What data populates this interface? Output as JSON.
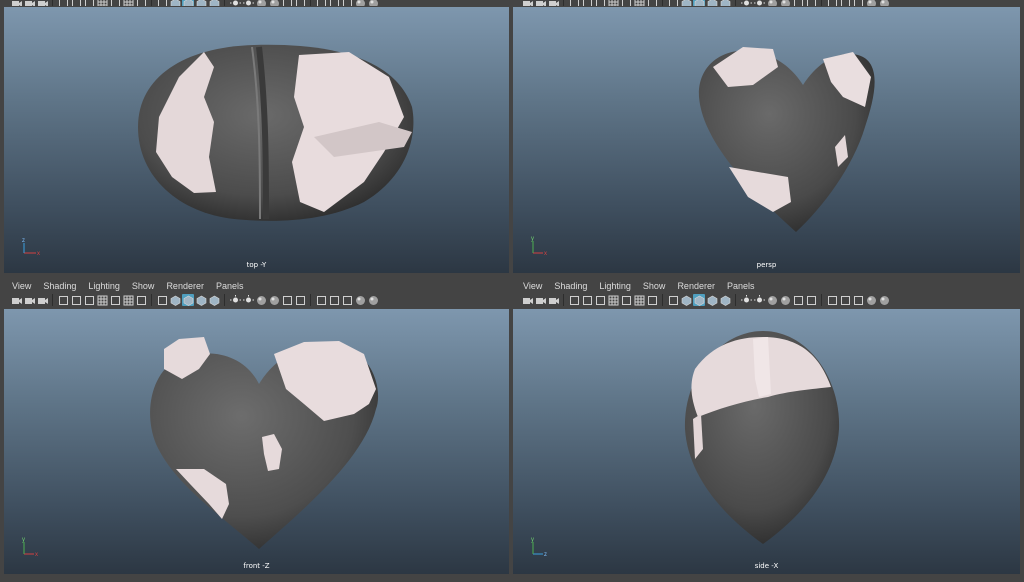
{
  "menu": [
    "View",
    "Shading",
    "Lighting",
    "Show",
    "Renderer",
    "Panels"
  ],
  "viewports": {
    "top_left": {
      "label": "top -Y"
    },
    "top_right": {
      "label": "persp"
    },
    "bottom_left": {
      "label": "front -Z"
    },
    "bottom_right": {
      "label": "side -X"
    }
  },
  "axes": {
    "x": "x",
    "y": "y",
    "z": "z"
  },
  "colors": {
    "accent": "#4f9fbf",
    "ui_bg": "#444444",
    "mesh": "#5a5a5a",
    "highlight": "#e6dadb"
  },
  "toolbar_icons": [
    "camera-icon",
    "camera-select-icon",
    "camera-lock-icon",
    "bookmark-icon",
    "film-gate-icon",
    "image-plane-icon",
    "grid-icon",
    "safe-area-icon",
    "resolution-gate-icon",
    "field-chart-icon",
    "xray-icon",
    "wireframe-icon",
    "smooth-shade-icon",
    "wireframe-on-shaded-icon",
    "textured-icon",
    "lights-icon",
    "shadows-icon",
    "ambient-occlusion-icon",
    "motion-blur-icon",
    "antialias-icon",
    "depth-of-field-icon",
    "isolate-select-icon",
    "xray-joints-icon",
    "xray-active-icon",
    "exposure-icon",
    "gamma-icon"
  ]
}
